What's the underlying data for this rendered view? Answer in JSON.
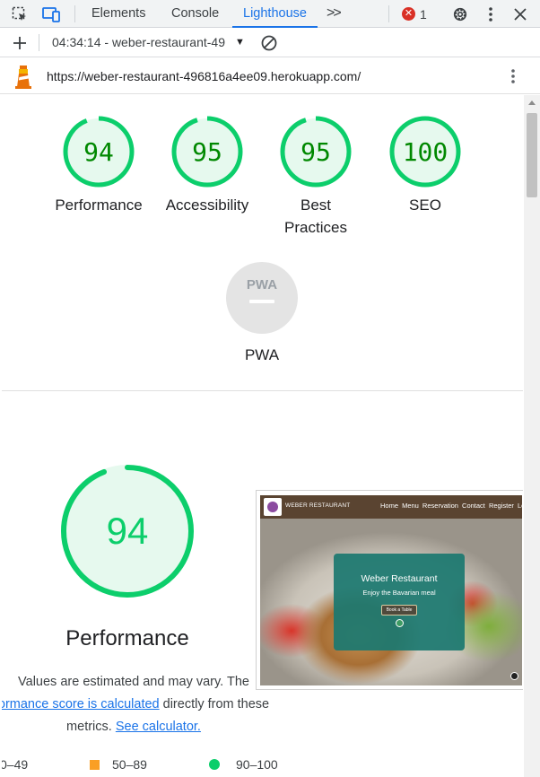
{
  "devtools": {
    "tabs": [
      {
        "label": "Elements",
        "active": false
      },
      {
        "label": "Console",
        "active": false
      },
      {
        "label": "Lighthouse",
        "active": true
      }
    ],
    "overflow_label": ">>",
    "error_count": "1",
    "icons": [
      "inspect-element-icon",
      "device-toolbar-icon",
      "overflow-chevron-icon",
      "error-icon",
      "settings-gear-icon",
      "more-vertical-icon",
      "close-icon"
    ]
  },
  "lighthouse_toolbar": {
    "report_label": "04:34:14 - weber-restaurant-49",
    "icons": [
      "add-icon",
      "dropdown-caret-icon",
      "clear-icon"
    ]
  },
  "url_bar": {
    "url": "https://weber-restaurant-496816a4ee09.herokuapp.com/",
    "icons": [
      "lighthouse-logo",
      "more-vertical-icon"
    ]
  },
  "summary_scores": [
    {
      "value": "94",
      "label": "Performance",
      "score": 94
    },
    {
      "value": "95",
      "label": "Accessibility",
      "score": 95
    },
    {
      "value": "95",
      "label_line1": "Best",
      "label_line2": "Practices",
      "score": 95
    },
    {
      "value": "100",
      "label": "SEO",
      "score": 100
    }
  ],
  "pwa": {
    "badge_text": "PWA",
    "label": "PWA"
  },
  "performance_detail": {
    "score": "94",
    "score_fraction": 0.94,
    "title": "Performance",
    "desc_line1": "Values are estimated and may vary. The",
    "desc_link1": "ormance score is calculated",
    "desc_line2_rest": " directly from these",
    "desc_line3_start": "metrics. ",
    "desc_link2": "See calculator.",
    "legend": [
      {
        "label": "0–49",
        "color": "#ff4e42"
      },
      {
        "label": "50–89",
        "color": "#fa9f24"
      },
      {
        "label": "90–100",
        "color": "#0cce6b"
      }
    ]
  },
  "screenshot_thumb": {
    "brand": "WEBER RESTAURANT",
    "nav_links": "Home  Menu  Reservation  Contact  Register  Login",
    "hero_title": "Weber Restaurant",
    "hero_subtitle": "Enjoy the Bavarian meal",
    "hero_button": "Book a Table"
  },
  "colors": {
    "pass_green": "#0cce6b",
    "pass_text": "#008800",
    "pass_fill": "#e6f9ee",
    "average_orange": "#fa9f24",
    "accent_blue": "#1a73e8",
    "pwa_gray": "#e4e4e4"
  }
}
